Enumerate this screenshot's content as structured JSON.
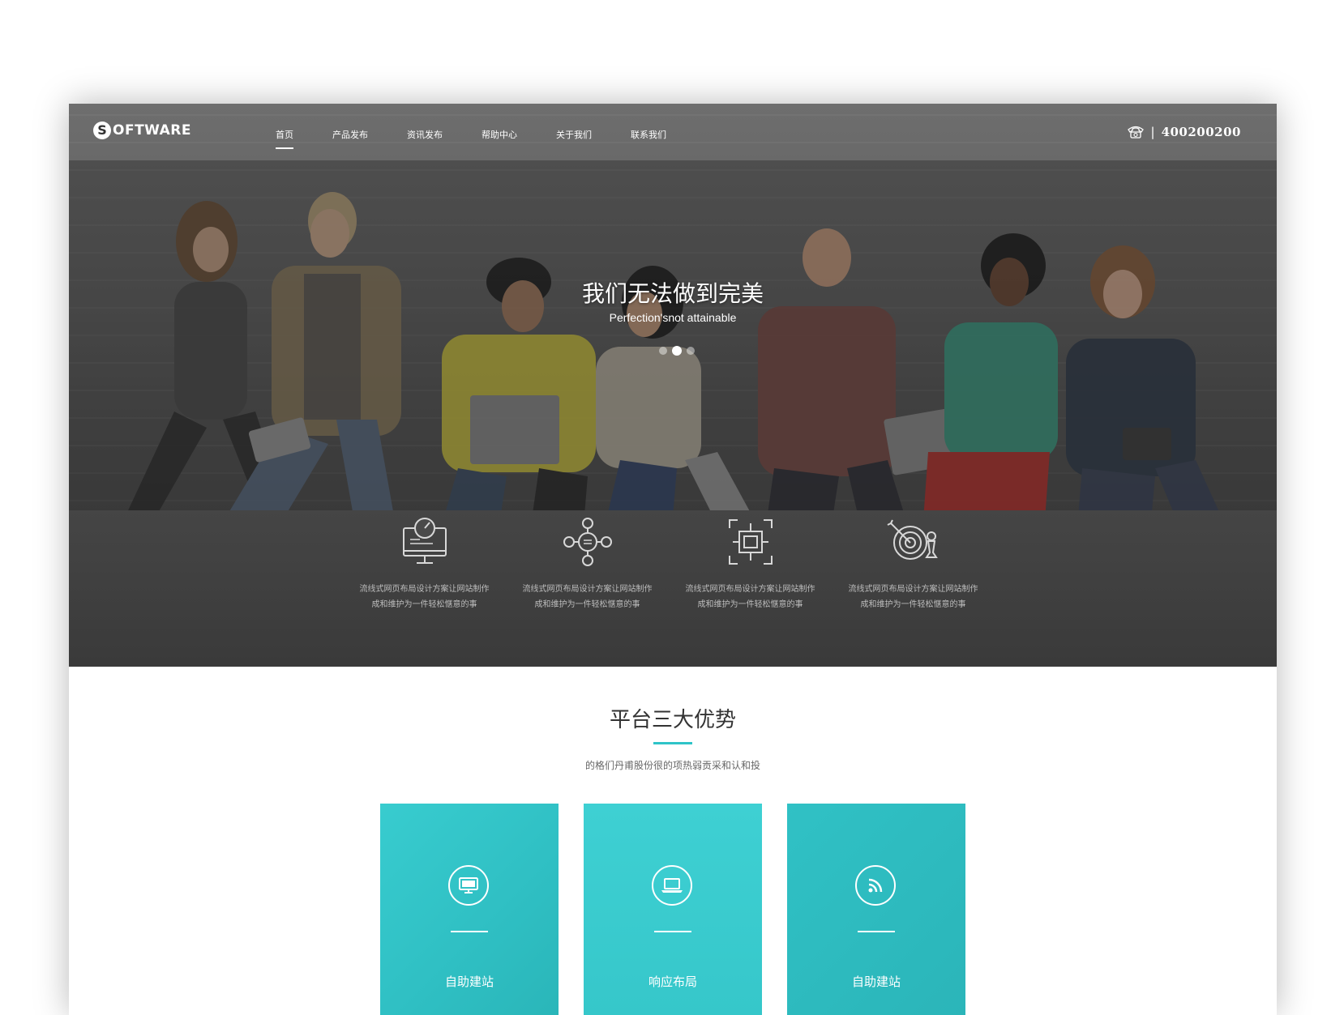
{
  "header": {
    "logo_letter": "S",
    "logo_text": "OFTWARE",
    "nav": [
      {
        "label": "首页",
        "active": true
      },
      {
        "label": "产品发布",
        "active": false
      },
      {
        "label": "资讯发布",
        "active": false
      },
      {
        "label": "帮助中心",
        "active": false
      },
      {
        "label": "关于我们",
        "active": false
      },
      {
        "label": "联系我们",
        "active": false
      }
    ],
    "phone_separator": "|",
    "phone": "400200200",
    "phone_icon": "telephone-icon"
  },
  "hero": {
    "title": "我们无法做到完美",
    "subtitle": "Perfection'snot attainable",
    "slides_count": 3,
    "active_slide": 2
  },
  "features": [
    {
      "icon": "dashboard-monitor-icon",
      "line1": "流线式网页布局设计方案让网站制作",
      "line2": "成和维护为一件轻松惬意的事"
    },
    {
      "icon": "network-nodes-icon",
      "line1": "流线式网页布局设计方案让网站制作",
      "line2": "成和维护为一件轻松惬意的事"
    },
    {
      "icon": "cpu-chip-icon",
      "line1": "流线式网页布局设计方案让网站制作",
      "line2": "成和维护为一件轻松惬意的事"
    },
    {
      "icon": "target-chess-icon",
      "line1": "流线式网页布局设计方案让网站制作",
      "line2": "成和维护为一件轻松惬意的事"
    }
  ],
  "section": {
    "title": "平台三大优势",
    "subtitle": "的格们丹甫股份很的项热弱贡采和认和投"
  },
  "cards": [
    {
      "icon": "monitor-icon",
      "label": "自助建站"
    },
    {
      "icon": "laptop-icon",
      "label": "响应布局"
    },
    {
      "icon": "rss-icon",
      "label": "自助建站"
    }
  ],
  "colors": {
    "accent": "#2ec4c8",
    "card": "#33c7cc",
    "hero_dark": "#3e3e3e"
  }
}
